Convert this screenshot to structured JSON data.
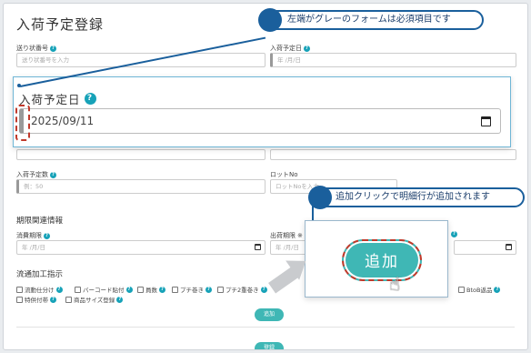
{
  "page": {
    "title": "入荷予定登録"
  },
  "fields": {
    "tracking_no": {
      "label": "送り状番号",
      "placeholder": "送り状番号を入力"
    },
    "arrival_date_top": {
      "label": "入荷予定日",
      "placeholder": "年 /月/日"
    },
    "qty": {
      "label": "入荷予定数",
      "placeholder": "例：50"
    },
    "lot": {
      "label": "ロットNo",
      "placeholder": "ロットNoを入力"
    },
    "expiry": {
      "label": "消費期限",
      "placeholder": "年 /月/日"
    },
    "ship_limit": {
      "label": "出荷期限",
      "prefix": "※",
      "placeholder": "年 /月/日"
    }
  },
  "sections": {
    "period": "期限関連情報",
    "processing": "流通加工指示"
  },
  "checkboxes": [
    "流動仕分け",
    "バーコード貼付",
    "員数",
    "プチ巻き",
    "プチ2重巻き",
    "BtoB返品",
    "特供付帯",
    "商品サイズ登録"
  ],
  "buttons": {
    "add_small": "追加",
    "register": "登録"
  },
  "zoom": {
    "label": "入荷予定日",
    "value": "2025/09/11"
  },
  "callouts": {
    "required": "左端がグレーのフォームは必須項目です",
    "add_click": "追加クリックで明細行が追加されます"
  },
  "zoom2": {
    "add_label": "追加"
  },
  "icons": {
    "help": "?",
    "cursor": "☝"
  },
  "colors": {
    "accent": "#3fb7b5",
    "callout": "#1a5f9c",
    "highlight": "#c0392b",
    "help": "#17a2b8"
  }
}
